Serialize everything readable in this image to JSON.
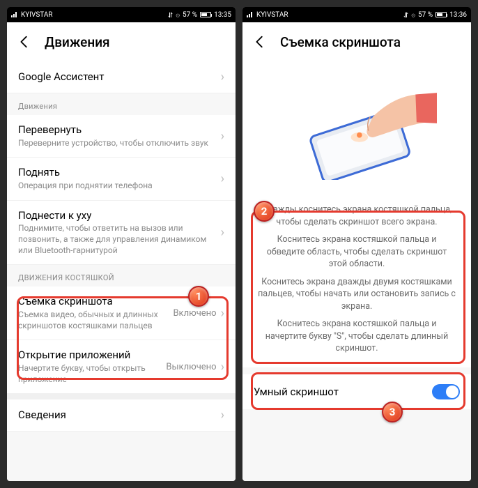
{
  "status": {
    "carrier": "KYIVSTAR",
    "battery_pct": "57 %",
    "time_left": "13:35",
    "time_right": "13:36"
  },
  "left": {
    "title": "Движения",
    "assistant": "Google Ассистент",
    "section1": "Движения",
    "flip_title": "Перевернуть",
    "flip_sub": "Переверните устройство, чтобы отключить звук",
    "raise_title": "Поднять",
    "raise_sub": "Операция при поднятии телефона",
    "ear_title": "Поднести к уху",
    "ear_sub": "Поднимите, чтобы ответить на вызов или позвонить, а также для управления динамиком или Bluetooth-гарнитурой",
    "knuckle_header": "ДВИЖЕНИЯ КОСТЯШКОЙ",
    "shot_title": "Съемка скриншота",
    "shot_sub": "Съемка видео, обычных и длинных скриншотов костяшками пальцев",
    "shot_value": "Включено",
    "open_title": "Открытие приложений",
    "open_sub": "Начертите букву, чтобы открыть приложение",
    "open_value": "Выключено",
    "info_title": "Сведения"
  },
  "right": {
    "title": "Съемка скриншота",
    "p1": "Дважды коснитесь экрана костяшкой пальца, чтобы сделать скриншот всего экрана.",
    "p2": "Коснитесь экрана костяшкой пальца и обведите область, чтобы сделать скриншот этой области.",
    "p3": "Коснитесь экрана дважды двумя костяшками пальцев, чтобы начать или остановить запись с экрана.",
    "p4": "Коснитесь экрана костяшкой пальца и начертите букву \"S\", чтобы сделать длинный скриншот.",
    "toggle_label": "Умный скриншот"
  },
  "markers": {
    "m1": "1",
    "m2": "2",
    "m3": "3"
  }
}
